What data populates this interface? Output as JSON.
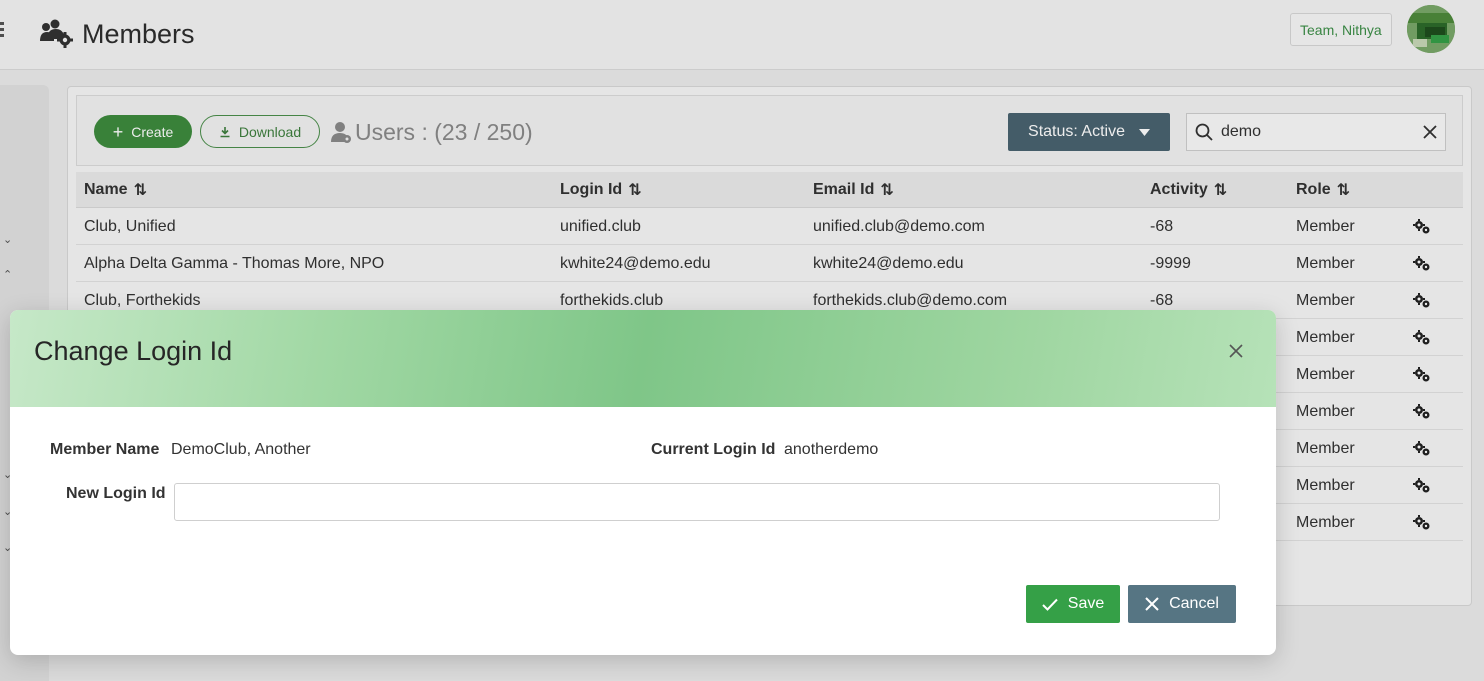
{
  "header": {
    "title": "Members",
    "team_badge": "Team, Nithya"
  },
  "toolbar": {
    "create_label": "Create",
    "download_label": "Download",
    "users_count": "Users : (23 / 250)",
    "status_label": "Status: Active",
    "search_value": "demo"
  },
  "table": {
    "columns": [
      "Name",
      "Login Id",
      "Email Id",
      "Activity",
      "Role"
    ],
    "rows": [
      {
        "name": "Club, Unified",
        "login": "unified.club",
        "email": "unified.club@demo.com",
        "activity": "-68",
        "role": "Member"
      },
      {
        "name": "Alpha Delta Gamma - Thomas More, NPO",
        "login": "kwhite24@demo.edu",
        "email": "kwhite24@demo.edu",
        "activity": "-9999",
        "role": "Member"
      },
      {
        "name": "Club, Forthekids",
        "login": "forthekids.club",
        "email": "forthekids.club@demo.com",
        "activity": "-68",
        "role": "Member"
      },
      {
        "name": "",
        "login": "",
        "email": "",
        "activity": "",
        "role": "Member"
      },
      {
        "name": "",
        "login": "",
        "email": "",
        "activity": "",
        "role": "Member"
      },
      {
        "name": "",
        "login": "",
        "email": "",
        "activity": "",
        "role": "Member"
      },
      {
        "name": "",
        "login": "",
        "email": "",
        "activity": "",
        "role": "Member"
      },
      {
        "name": "",
        "login": "",
        "email": "",
        "activity": "",
        "role": "Member"
      },
      {
        "name": "",
        "login": "",
        "email": "",
        "activity": "",
        "role": "Member"
      }
    ]
  },
  "modal": {
    "title": "Change Login Id",
    "member_name_label": "Member Name",
    "member_name_value": "DemoClub, Another",
    "current_login_label": "Current Login Id",
    "current_login_value": "anotherdemo",
    "new_login_label": "New Login Id",
    "new_login_value": "",
    "save_label": "Save",
    "cancel_label": "Cancel"
  },
  "colors": {
    "accent_green": "#3e8b3e",
    "save_green": "#35a047",
    "slate": "#4a6370"
  }
}
